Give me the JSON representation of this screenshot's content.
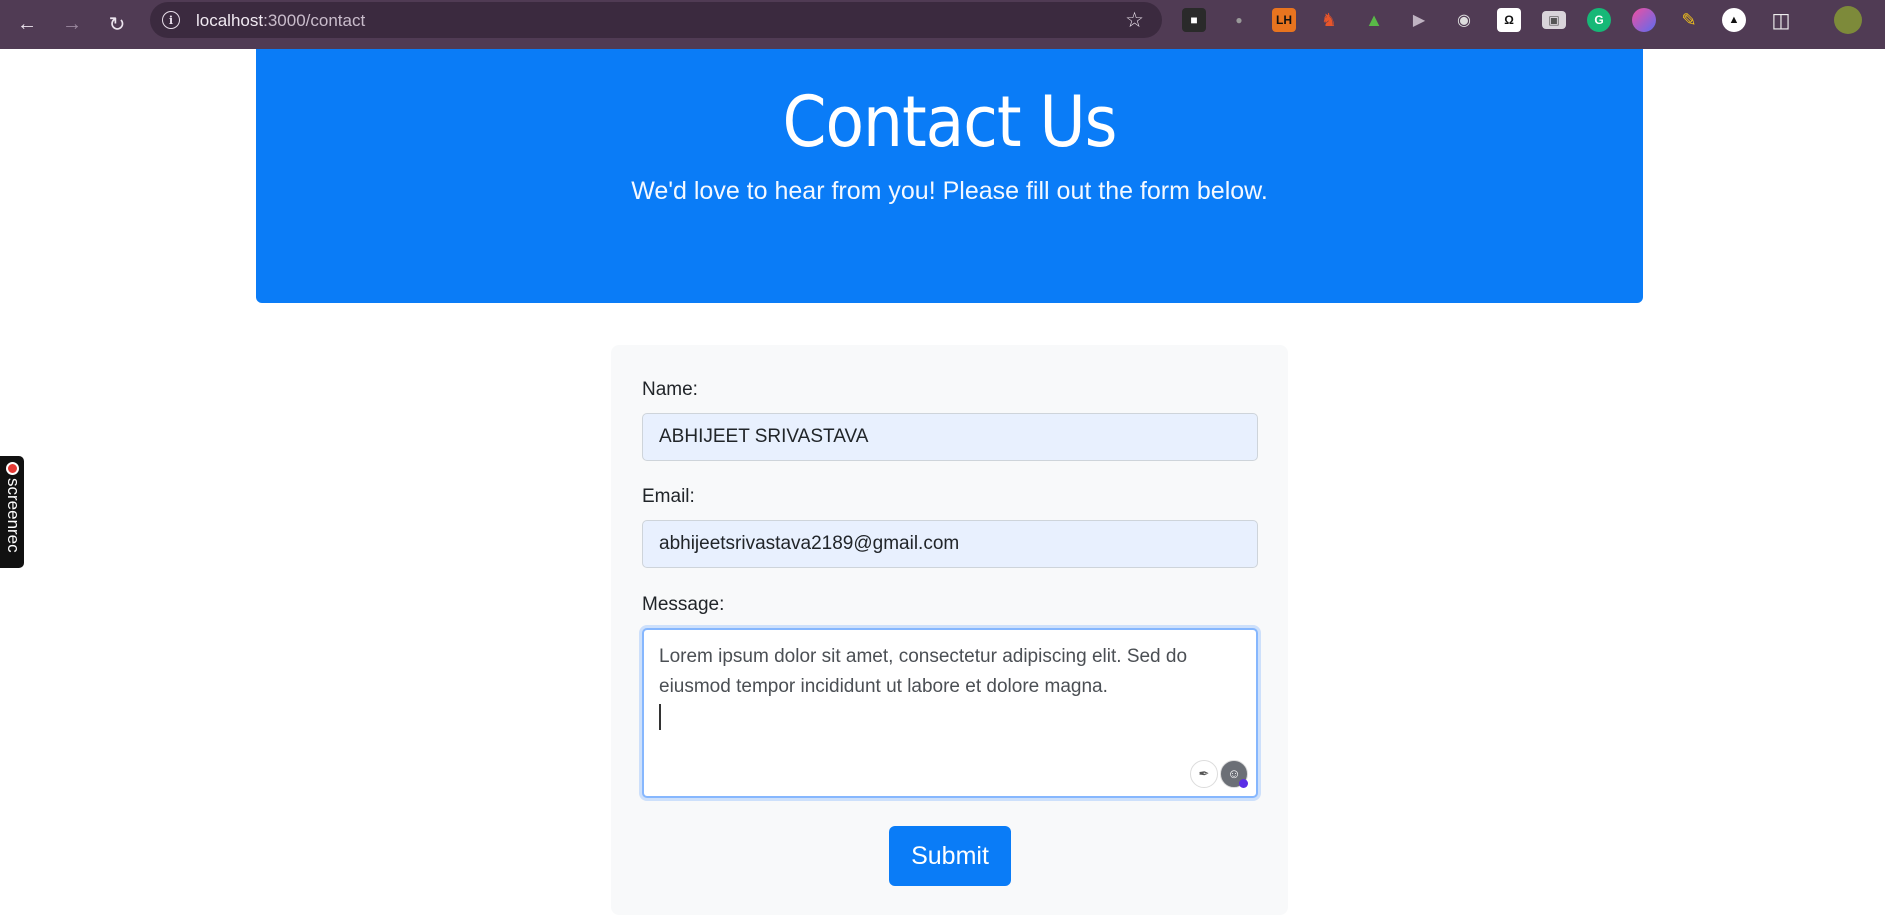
{
  "browser": {
    "url_host": "localhost",
    "url_path": ":3000/contact",
    "extensions": [
      "ext-ninja",
      "ext-bulb",
      "ext-lh",
      "ext-chess",
      "ext-tree",
      "ext-play",
      "ext-cat",
      "ext-omega",
      "ext-window",
      "ext-grammarly",
      "ext-brain",
      "ext-pencil",
      "ext-triangle",
      "ext-puzzle"
    ],
    "extension_labels": {
      "lh": "LH",
      "omega": "Ω",
      "grammarly": "G"
    }
  },
  "hero": {
    "title": "Contact Us",
    "subtitle": "We'd love to hear from you! Please fill out the form below."
  },
  "form": {
    "name_label": "Name:",
    "name_value": "ABHIJEET SRIVASTAVA",
    "email_label": "Email:",
    "email_value": "abhijeetsrivastava2189@gmail.com",
    "message_label": "Message:",
    "message_value": "Lorem ipsum dolor sit amet, consectetur adipiscing elit. Sed do eiusmod tempor incididunt ut labore et dolore magna.",
    "submit_label": "Submit"
  },
  "screenrec": {
    "label": "screenrec"
  },
  "colors": {
    "primary": "#0a7cf7",
    "chrome": "#503b54",
    "card": "#f8f9fa"
  }
}
